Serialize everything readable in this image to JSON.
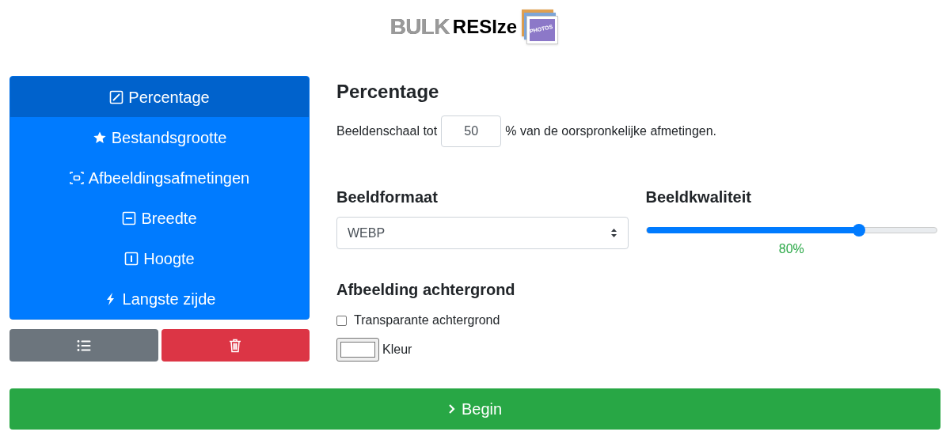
{
  "logo": {
    "word_1": "BULK",
    "word_2": "RESIze",
    "badge": "PHOTOS"
  },
  "sidebar": {
    "items": [
      {
        "label": "Percentage",
        "kind": "percentage",
        "selected": true
      },
      {
        "label": "Bestandsgrootte",
        "kind": "filesize",
        "selected": false
      },
      {
        "label": "Afbeeldingsafmetingen",
        "kind": "dimensions",
        "selected": false
      },
      {
        "label": "Breedte",
        "kind": "width",
        "selected": false
      },
      {
        "label": "Hoogte",
        "kind": "height",
        "selected": false
      },
      {
        "label": "Langste zijde",
        "kind": "longest",
        "selected": false
      }
    ]
  },
  "actions": [
    {
      "kind": "list"
    },
    {
      "kind": "delete"
    }
  ],
  "main": {
    "title": "Percentage",
    "scale_prefix": "Beeldenschaal tot",
    "scale_value": "50",
    "scale_suffix": "% van de oorspronkelijke afmetingen.",
    "format": {
      "label": "Beeldformaat",
      "value": "WEBP"
    },
    "quality": {
      "label": "Beeldkwaliteit",
      "level": 0.73,
      "reading": "80%"
    },
    "background": {
      "label": "Afbeelding achtergrond",
      "transparent": {
        "label": "Transparante achtergrond",
        "checked": false
      },
      "color_label": "Kleur",
      "color": "#ffffff"
    }
  },
  "start_button": {
    "label": "Begin"
  }
}
